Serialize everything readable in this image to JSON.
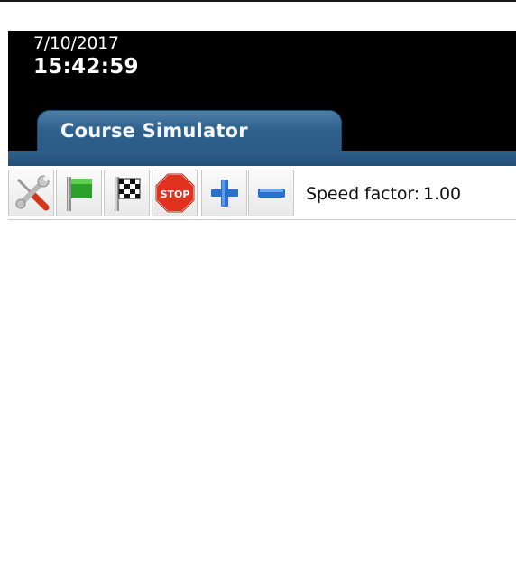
{
  "header": {
    "date": "7/10/2017",
    "time": "15:42:59"
  },
  "tabs": [
    {
      "label": "Course Simulator",
      "active": true
    }
  ],
  "toolbar": {
    "buttons": [
      {
        "name": "settings-tools",
        "icon": "wrench-screwdriver-icon"
      },
      {
        "name": "start",
        "icon": "green-flag-icon"
      },
      {
        "name": "finish",
        "icon": "checkered-flag-icon"
      },
      {
        "name": "stop",
        "icon": "stop-sign-icon",
        "label": "STOP"
      },
      {
        "name": "speed-increase",
        "icon": "plus-icon"
      },
      {
        "name": "speed-decrease",
        "icon": "minus-icon"
      }
    ],
    "speed_label": "Speed factor:",
    "speed_value": "1.00"
  },
  "colors": {
    "header_bg": "#000000",
    "tab_blue": "#2f618d",
    "flag_green": "#2aa12a",
    "stop_red": "#e0321e",
    "action_blue": "#2a6fd2"
  }
}
